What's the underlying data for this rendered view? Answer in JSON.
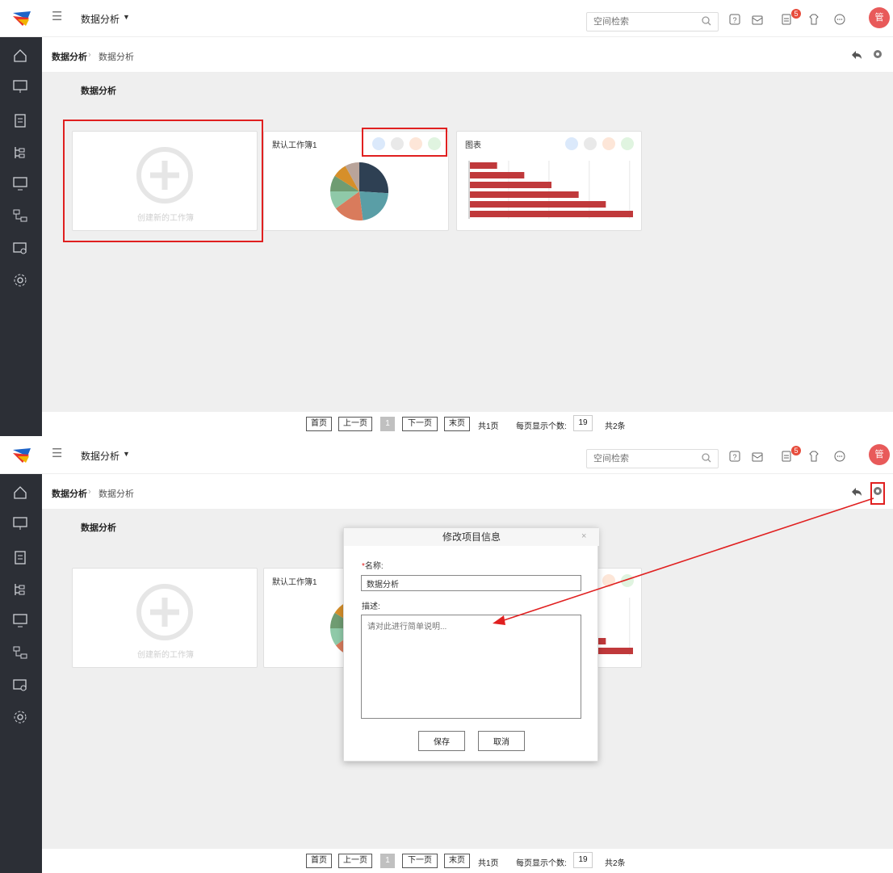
{
  "header": {
    "app_title": "数据分析",
    "search_placeholder": "空间检索",
    "notification_count": "5",
    "avatar_text": "管"
  },
  "breadcrumb": {
    "root": "数据分析",
    "current": "数据分析"
  },
  "content": {
    "section_title": "数据分析",
    "create_card_label": "创建新的工作簿",
    "workbook_card_title": "默认工作簿1",
    "chart_card_title": "图表"
  },
  "pager": {
    "first": "首页",
    "prev": "上一页",
    "current_page": "1",
    "next": "下一页",
    "last": "末页",
    "total_pages": "共1页",
    "page_size_label": "每页显示个数:",
    "page_size": "19",
    "total_items": "共2条"
  },
  "modal": {
    "title": "修改项目信息",
    "close": "×",
    "name_label_required": "*",
    "name_label": "名称:",
    "name_value": "数据分析",
    "desc_label": "描述:",
    "desc_placeholder": "请对此进行简单说明...",
    "save": "保存",
    "cancel": "取消"
  },
  "colors": {
    "sidebar_bg": "#2c2f36",
    "content_bg": "#efefef",
    "highlight": "#e02020",
    "bar_color": "#c0393b",
    "avatar_bg": "#e85a5a",
    "pie_slices": [
      "#2e4053",
      "#5a9ea6",
      "#d97b5c",
      "#8fc9a8",
      "#6f9c72",
      "#d68f2a",
      "#b9a49a"
    ]
  },
  "chart_data": [
    {
      "type": "pie",
      "title": "",
      "values": [
        26,
        22,
        17,
        10,
        9,
        8,
        8
      ]
    },
    {
      "type": "bar",
      "orientation": "horizontal",
      "title": "",
      "categories": [
        "",
        "",
        "",
        "",
        "",
        ""
      ],
      "values": [
        1,
        2,
        3,
        4,
        5,
        6
      ],
      "xlim": [
        0,
        6
      ]
    }
  ],
  "sidebar": {
    "icons": [
      "home-icon",
      "presentation-icon",
      "clipboard-icon",
      "tree-icon",
      "monitor-icon",
      "flow-icon",
      "device-settings-icon",
      "gear-icon"
    ]
  }
}
